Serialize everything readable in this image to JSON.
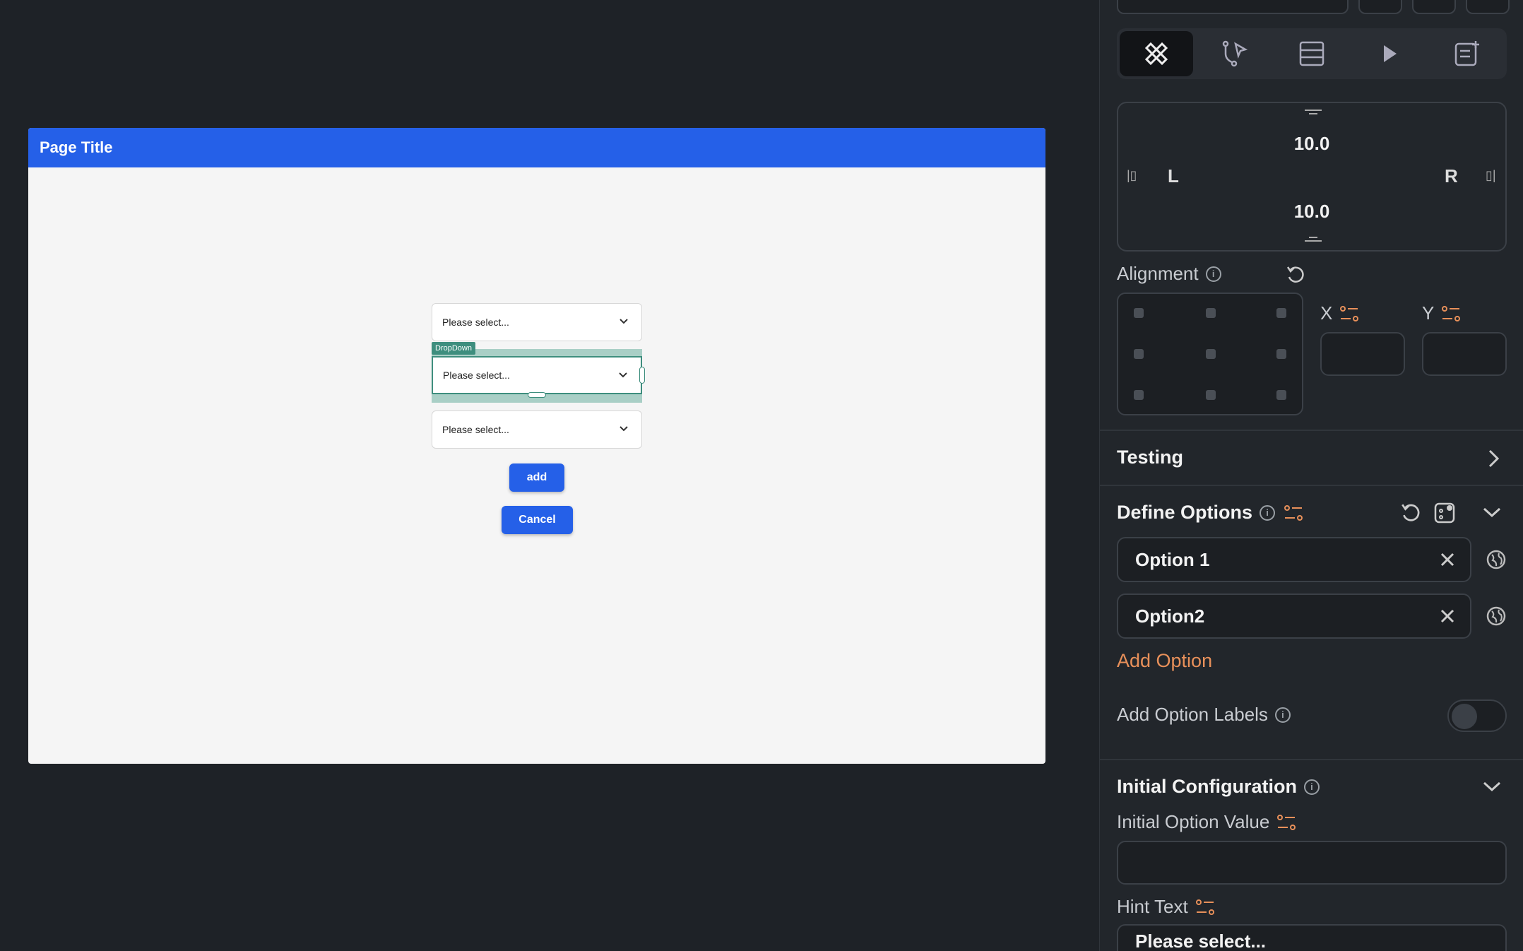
{
  "canvas": {
    "page_title": "Page Title",
    "dropdowns": [
      {
        "placeholder": "Please select..."
      },
      {
        "placeholder": "Please select..."
      },
      {
        "placeholder": "Please select..."
      }
    ],
    "selection_tag": "DropDown",
    "add_button": "add",
    "cancel_button": "Cancel"
  },
  "panel": {
    "mode_tabs": [
      "design-icon",
      "actions-icon",
      "backend-query-icon",
      "run-icon",
      "add-note-icon"
    ],
    "padding": {
      "top": "10.0",
      "bottom": "10.0",
      "left": "L",
      "right": "R"
    },
    "alignment": {
      "label": "Alignment",
      "x_label": "X",
      "y_label": "Y"
    },
    "testing": {
      "label": "Testing"
    },
    "define_options": {
      "label": "Define Options",
      "options": [
        "Option 1",
        "Option2"
      ],
      "add_option": "Add Option",
      "add_option_labels": "Add Option Labels"
    },
    "initial_config": {
      "label": "Initial Configuration",
      "initial_option_value": "Initial Option Value",
      "hint_text_label": "Hint Text",
      "hint_text_value": "Please select..."
    }
  },
  "colors": {
    "accent": "#2560e8",
    "selection": "#3e8e7e",
    "orange": "#e8905a",
    "panel_bg": "#22262b"
  }
}
